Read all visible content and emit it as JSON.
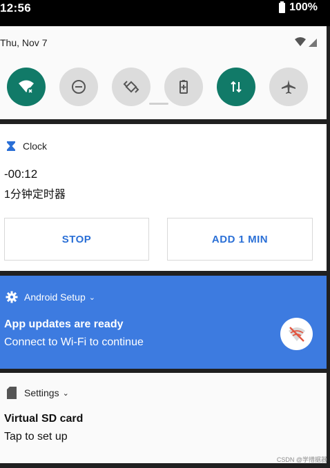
{
  "status_bar": {
    "time": "12:56",
    "battery": "100%"
  },
  "quick_settings": {
    "date": "Thu, Nov 7",
    "tiles": [
      {
        "icon": "wifi-off-icon",
        "state": "on"
      },
      {
        "icon": "do-not-disturb-icon",
        "state": "off"
      },
      {
        "icon": "auto-rotate-icon",
        "state": "off"
      },
      {
        "icon": "battery-saver-icon",
        "state": "off"
      },
      {
        "icon": "mobile-data-icon",
        "state": "on"
      },
      {
        "icon": "airplane-mode-icon",
        "state": "off"
      }
    ],
    "accent": "#117a68"
  },
  "clock_notification": {
    "app_name": "Clock",
    "time_remaining": "-00:12",
    "timer_label": "1分钟定时器",
    "stop_label": "STOP",
    "add_label": "ADD 1 MIN"
  },
  "setup_notification": {
    "app_name": "Android Setup",
    "title": "App updates are ready",
    "text": "Connect to Wi-Fi to continue",
    "background": "#3d7be0"
  },
  "settings_notification": {
    "app_name": "Settings",
    "title": "Virtual SD card",
    "text": "Tap to set up"
  },
  "watermark": "CSDN @学措据器"
}
